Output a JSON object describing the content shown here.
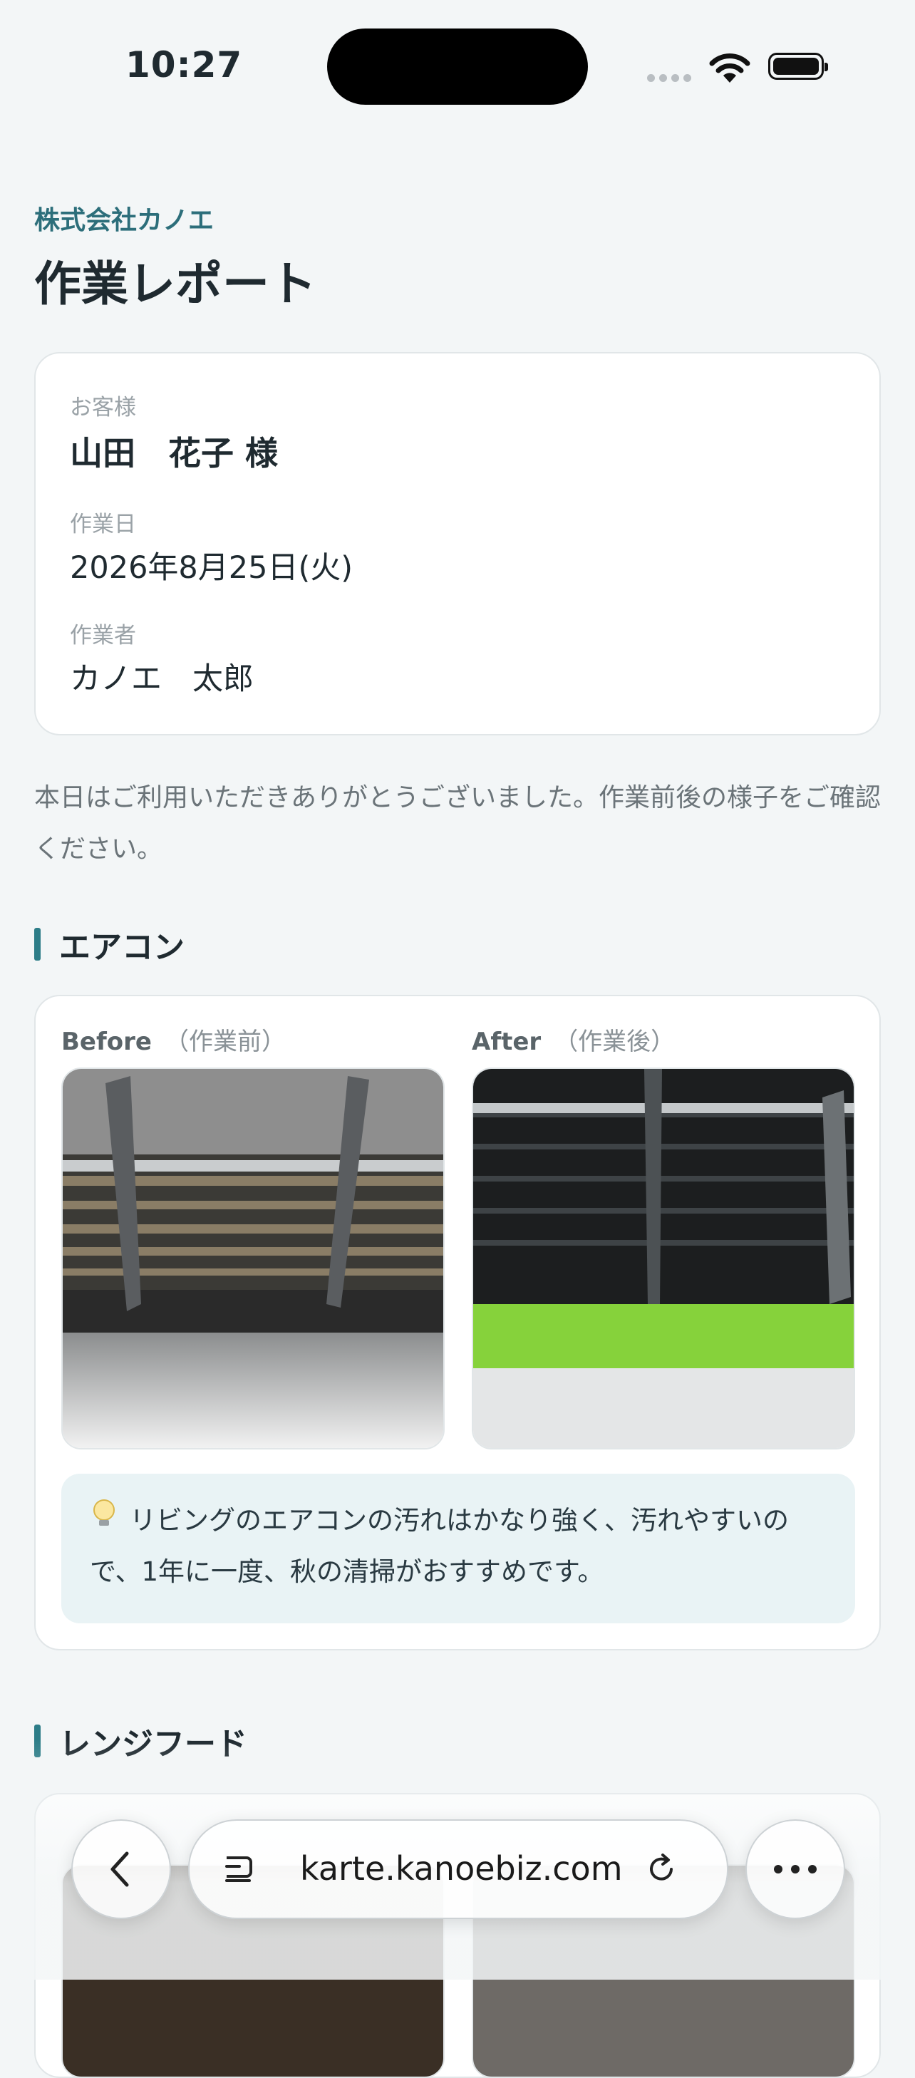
{
  "status_bar": {
    "time": "10:27"
  },
  "header": {
    "company": "株式会社カノエ",
    "title": "作業レポート"
  },
  "info": {
    "customer_label": "お客様",
    "customer_value": "山田　花子 様",
    "date_label": "作業日",
    "date_value": "2026年8月25日(火)",
    "worker_label": "作業者",
    "worker_value": "カノエ　太郎"
  },
  "intro_text": "本日はご利用いただきありがとうございました。作業前後の様子をご確認ください。",
  "sections": [
    {
      "title": "エアコン",
      "before_label": "Before",
      "before_sub": "（作業前）",
      "after_label": "After",
      "after_sub": "（作業後）",
      "tip": "リビングのエアコンの汚れはかなり強く、汚れやすいので、1年に一度、秋の清掃がおすすめです。"
    },
    {
      "title": "レンジフード"
    }
  ],
  "browser": {
    "url": "karte.kanoebiz.com"
  },
  "icons": [
    "wifi-icon",
    "battery-icon",
    "lightbulb-icon",
    "back-icon",
    "tabs-icon",
    "reload-icon",
    "more-icon"
  ]
}
